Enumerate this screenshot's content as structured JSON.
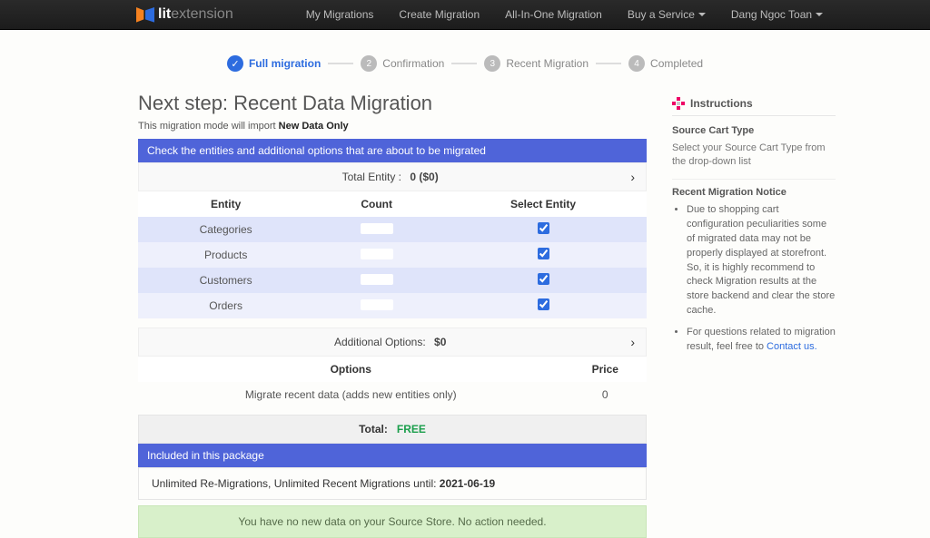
{
  "nav": {
    "brand_main": "lit",
    "brand_sub": "extension",
    "items": [
      "My Migrations",
      "Create Migration",
      "All-In-One Migration",
      "Buy a Service",
      "Dang Ngoc Toan"
    ]
  },
  "stepper": {
    "s1": "Full migration",
    "s2": "Confirmation",
    "s3": "Recent Migration",
    "s4": "Completed"
  },
  "heading": "Next step: Recent Data Migration",
  "subtitle_prefix": "This migration mode will import ",
  "subtitle_bold": "New Data Only",
  "panel_check": "Check the entities and additional options that are about to be migrated",
  "total_entity_label": "Total Entity :",
  "total_entity_value": "0 ($0)",
  "entity_table": {
    "h1": "Entity",
    "h2": "Count",
    "h3": "Select Entity",
    "rows": [
      "Categories",
      "Products",
      "Customers",
      "Orders"
    ]
  },
  "additional_label": "Additional Options:",
  "additional_value": "$0",
  "options_table": {
    "h1": "Options",
    "h2": "Price",
    "row1_name": "Migrate recent data (adds new entities only)",
    "row1_price": "0"
  },
  "total_label": "Total:",
  "total_value": "FREE",
  "included_header": "Included in this package",
  "package_line_prefix": "Unlimited Re-Migrations, Unlimited Recent Migrations until: ",
  "package_line_date": "2021-06-19",
  "no_data_alert": "You have no new data on your Source Store. No action needed.",
  "sidebar": {
    "title": "Instructions",
    "source_cart_type": "Source Cart Type",
    "source_cart_desc": "Select your Source Cart Type from the drop-down list",
    "notice_title": "Recent Migration Notice",
    "bullet1": "Due to shopping cart configuration peculiarities some of migrated data may not be properly displayed at storefront. So, it is highly recommend to check Migration results at the store backend and clear the store cache.",
    "bullet2_prefix": "For questions related to migration result, feel free to ",
    "bullet2_link": "Contact us."
  }
}
